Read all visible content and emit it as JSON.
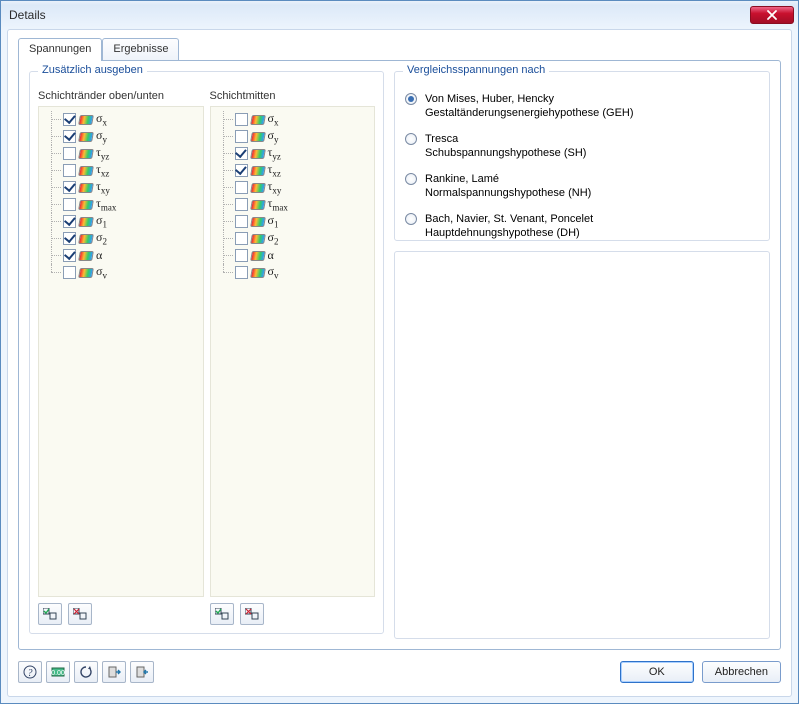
{
  "window": {
    "title": "Details"
  },
  "tabs": [
    {
      "label": "Spannungen",
      "active": true
    },
    {
      "label": "Ergebnisse",
      "active": false
    }
  ],
  "left": {
    "legend": "Zusätzlich ausgeben",
    "col1_header": "Schichtränder oben/unten",
    "col2_header": "Schichtmitten",
    "items": [
      {
        "sym": "σ",
        "sub": "x",
        "c1": true,
        "c2": false
      },
      {
        "sym": "σ",
        "sub": "y",
        "c1": true,
        "c2": false
      },
      {
        "sym": "τ",
        "sub": "yz",
        "c1": false,
        "c2": true
      },
      {
        "sym": "τ",
        "sub": "xz",
        "c1": false,
        "c2": true
      },
      {
        "sym": "τ",
        "sub": "xy",
        "c1": true,
        "c2": false
      },
      {
        "sym": "τ",
        "sub": "max",
        "c1": false,
        "c2": false
      },
      {
        "sym": "σ",
        "sub": "1",
        "c1": true,
        "c2": false
      },
      {
        "sym": "σ",
        "sub": "2",
        "c1": true,
        "c2": false
      },
      {
        "sym": "α",
        "sub": "",
        "c1": true,
        "c2": false
      },
      {
        "sym": "σ",
        "sub": "v",
        "c1": false,
        "c2": false
      }
    ]
  },
  "right": {
    "legend": "Vergleichsspannungen nach",
    "options": [
      {
        "line1": "Von Mises, Huber, Hencky",
        "line2": "Gestaltänderungsenergiehypothese (GEH)",
        "selected": true
      },
      {
        "line1": "Tresca",
        "line2": "Schubspannungshypothese (SH)",
        "selected": false
      },
      {
        "line1": "Rankine, Lamé",
        "line2": "Normalspannungshypothese (NH)",
        "selected": false
      },
      {
        "line1": "Bach, Navier, St. Venant, Poncelet",
        "line2": "Hauptdehnungshypothese (DH)",
        "selected": false
      }
    ]
  },
  "buttons": {
    "ok": "OK",
    "cancel": "Abbrechen"
  }
}
